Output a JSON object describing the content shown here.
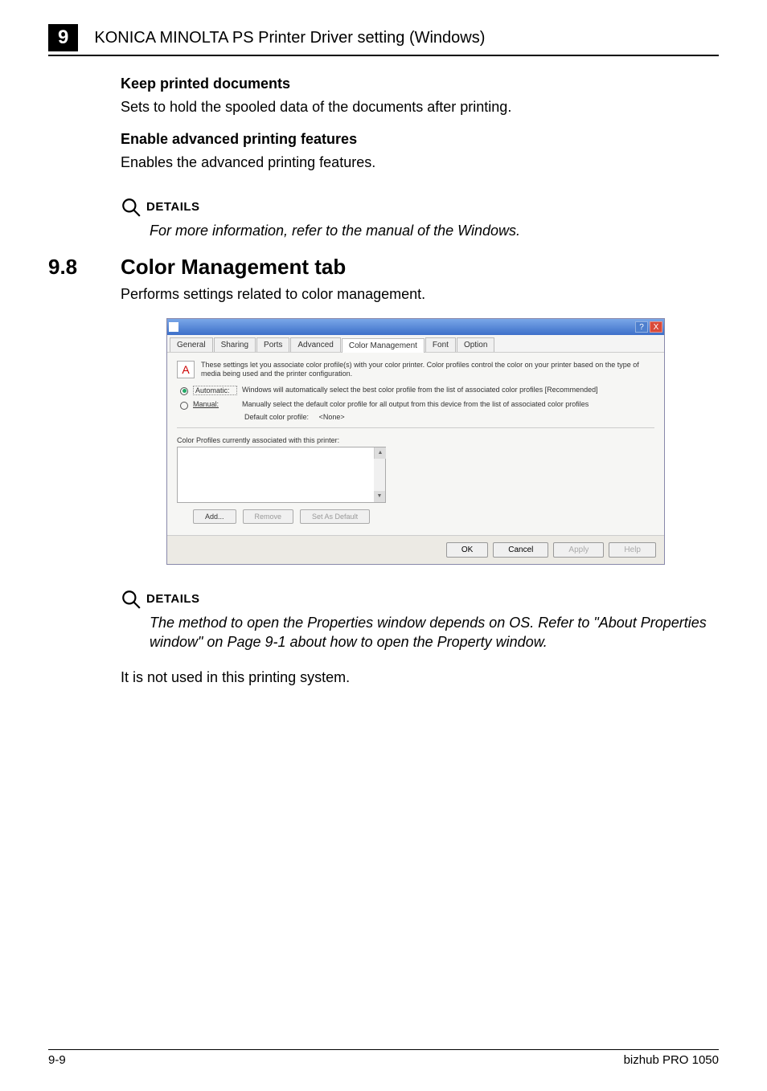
{
  "header": {
    "chapter_number": "9",
    "title": "KONICA MINOLTA PS Printer Driver setting (Windows)"
  },
  "sections": {
    "keep_printed": {
      "heading": "Keep printed documents",
      "text": "Sets to hold the spooled data of the documents after printing."
    },
    "enable_advanced": {
      "heading": "Enable advanced printing features",
      "text": "Enables the advanced printing features."
    },
    "details1": {
      "label": "DETAILS",
      "text": "For more information, refer to the manual of the Windows."
    },
    "color_mgmt": {
      "number": "9.8",
      "title": "Color Management tab",
      "intro": "Performs settings related to color management."
    },
    "details2": {
      "label": "DETAILS",
      "text": "The method to open the Properties window depends on OS. Refer to \"About Properties window\" on Page 9-1 about how to open the Property window."
    },
    "closing": "It is not used in this printing system."
  },
  "dialog": {
    "tabs": [
      "General",
      "Sharing",
      "Ports",
      "Advanced",
      "Color Management",
      "Font",
      "Option"
    ],
    "intro": "These settings let you associate color profile(s) with your color printer. Color profiles control the color on your printer based on the type of media being used and the printer configuration.",
    "automatic": {
      "label": "Automatic:",
      "desc": "Windows will automatically select the best color profile from the list of associated color profiles [Recommended]"
    },
    "manual": {
      "label": "Manual:",
      "desc": "Manually select the default color profile for all output from this device from the list of associated color profiles",
      "default_label": "Default color profile:",
      "default_value": "<None>"
    },
    "profiles_label": "Color Profiles currently associated with this printer:",
    "buttons": {
      "add": "Add...",
      "remove": "Remove",
      "set_default": "Set As Default"
    },
    "footer": {
      "ok": "OK",
      "cancel": "Cancel",
      "apply": "Apply",
      "help": "Help"
    },
    "titlebar": {
      "help": "?",
      "close": "X"
    }
  },
  "footer": {
    "page": "9-9",
    "product": "bizhub PRO 1050"
  }
}
